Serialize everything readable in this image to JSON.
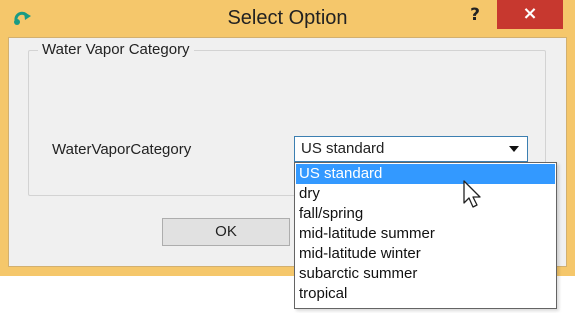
{
  "window": {
    "title": "Select Option",
    "help_label": "?",
    "close_label": "×",
    "icon": "refresh-arrow-icon",
    "accent_color": "#f5c76b",
    "close_color": "#c7382f"
  },
  "group": {
    "title": "Water Vapor Category",
    "field_label": "WaterVaporCategory",
    "selected_value": "US standard",
    "options": [
      {
        "label": "US standard",
        "selected": true
      },
      {
        "label": "dry",
        "selected": false
      },
      {
        "label": "fall/spring",
        "selected": false
      },
      {
        "label": "mid-latitude summer",
        "selected": false
      },
      {
        "label": "mid-latitude winter",
        "selected": false
      },
      {
        "label": "subarctic summer",
        "selected": false
      },
      {
        "label": "tropical",
        "selected": false
      }
    ],
    "highlight_color": "#3399ff"
  },
  "buttons": {
    "ok_label": "OK"
  }
}
